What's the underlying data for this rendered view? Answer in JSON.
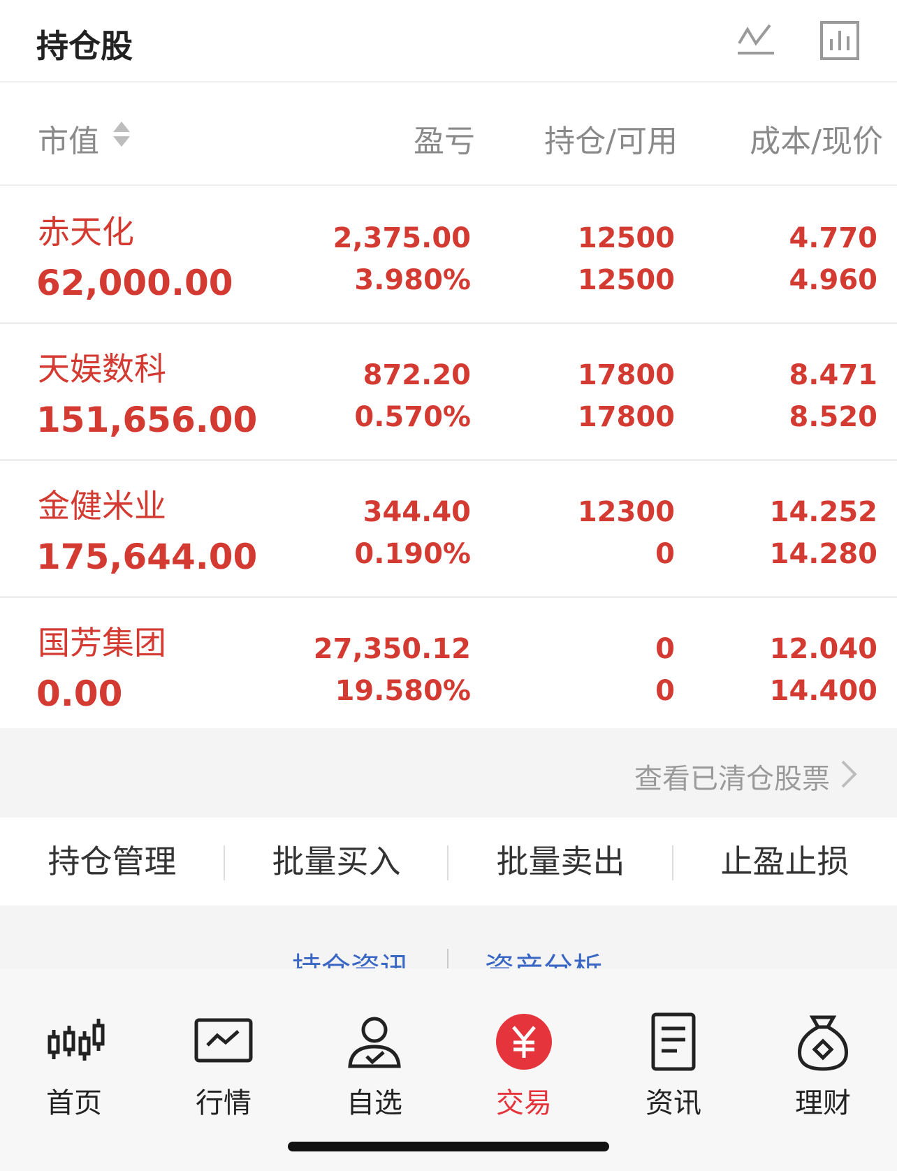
{
  "header": {
    "title": "持仓股"
  },
  "columns": {
    "market_value": "市值",
    "profit_loss": "盈亏",
    "position": "持仓/可用",
    "cost_price": "成本/现价"
  },
  "rows": [
    {
      "name": "赤天化",
      "market_value": "62,000.00",
      "pl_amount": "2,375.00",
      "pl_percent": "3.980%",
      "holding": "12500",
      "available": "12500",
      "cost": "4.770",
      "price": "4.960"
    },
    {
      "name": "天娱数科",
      "market_value": "151,656.00",
      "pl_amount": "872.20",
      "pl_percent": "0.570%",
      "holding": "17800",
      "available": "17800",
      "cost": "8.471",
      "price": "8.520"
    },
    {
      "name": "金健米业",
      "market_value": "175,644.00",
      "pl_amount": "344.40",
      "pl_percent": "0.190%",
      "holding": "12300",
      "available": "0",
      "cost": "14.252",
      "price": "14.280"
    },
    {
      "name": "国芳集团",
      "market_value": "0.00",
      "pl_amount": "27,350.12",
      "pl_percent": "19.580%",
      "holding": "0",
      "available": "0",
      "cost": "12.040",
      "price": "14.400"
    }
  ],
  "cleared_link": "查看已清仓股票",
  "actions": [
    "持仓管理",
    "批量买入",
    "批量卖出",
    "止盈止损"
  ],
  "info_links": [
    "持仓资讯",
    "资产分析"
  ],
  "nav": [
    {
      "label": "首页",
      "icon": "candlestick-icon"
    },
    {
      "label": "行情",
      "icon": "market-chart-icon"
    },
    {
      "label": "自选",
      "icon": "user-check-icon"
    },
    {
      "label": "交易",
      "icon": "yen-circle-icon",
      "active": true
    },
    {
      "label": "资讯",
      "icon": "document-icon"
    },
    {
      "label": "理财",
      "icon": "money-bag-icon"
    }
  ],
  "colors": {
    "up_red": "#d33a31",
    "active_red": "#e5343b",
    "link_blue": "#3a66c4"
  }
}
